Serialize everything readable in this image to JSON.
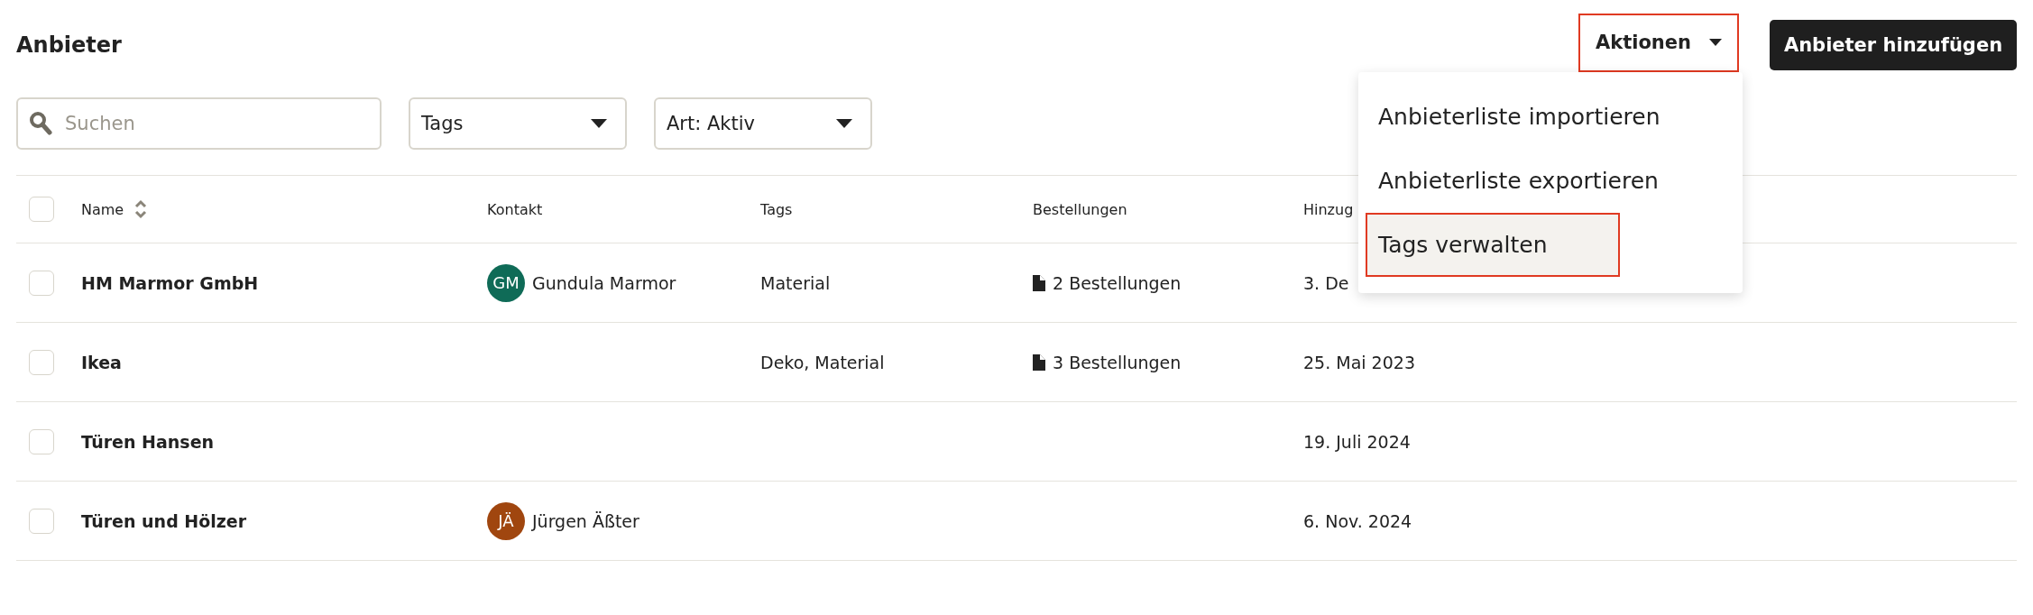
{
  "title": "Anbieter",
  "actions_button": {
    "label": "Aktionen",
    "highlighted": true
  },
  "add_button": {
    "label": "Anbieter hinzufügen"
  },
  "search": {
    "placeholder": "Suchen"
  },
  "filters": [
    {
      "label": "Tags"
    },
    {
      "label": "Art: Aktiv"
    }
  ],
  "actions_menu": [
    {
      "label": "Anbieterliste importieren",
      "selected": false,
      "highlighted": false
    },
    {
      "label": "Anbieterliste exportieren",
      "selected": false,
      "highlighted": false
    },
    {
      "label": "Tags verwalten",
      "selected": true,
      "highlighted": true
    }
  ],
  "table": {
    "select_all": {
      "checked": false
    },
    "columns": [
      "Name",
      "Kontakt",
      "Tags",
      "Bestellungen",
      "Hinzug"
    ],
    "rows": [
      {
        "checked": false,
        "name": "HM Marmor GmbH",
        "contact": {
          "initials": "GM",
          "name": "Gundula Marmor",
          "color": "#0f6b57"
        },
        "tags": "Material",
        "orders": "2 Bestellungen",
        "added": "3. De"
      },
      {
        "checked": false,
        "name": "Ikea",
        "tags": "Deko, Material",
        "orders": "3 Bestellungen",
        "added": "25. Mai 2023"
      },
      {
        "checked": false,
        "name": "Türen Hansen",
        "added": "19. Juli 2024"
      },
      {
        "checked": false,
        "name": "Türen und Hölzer",
        "contact": {
          "initials": "JÄ",
          "name": "Jürgen Äßter",
          "color": "#a0460f"
        },
        "added": "6. Nov. 2024"
      }
    ]
  }
}
